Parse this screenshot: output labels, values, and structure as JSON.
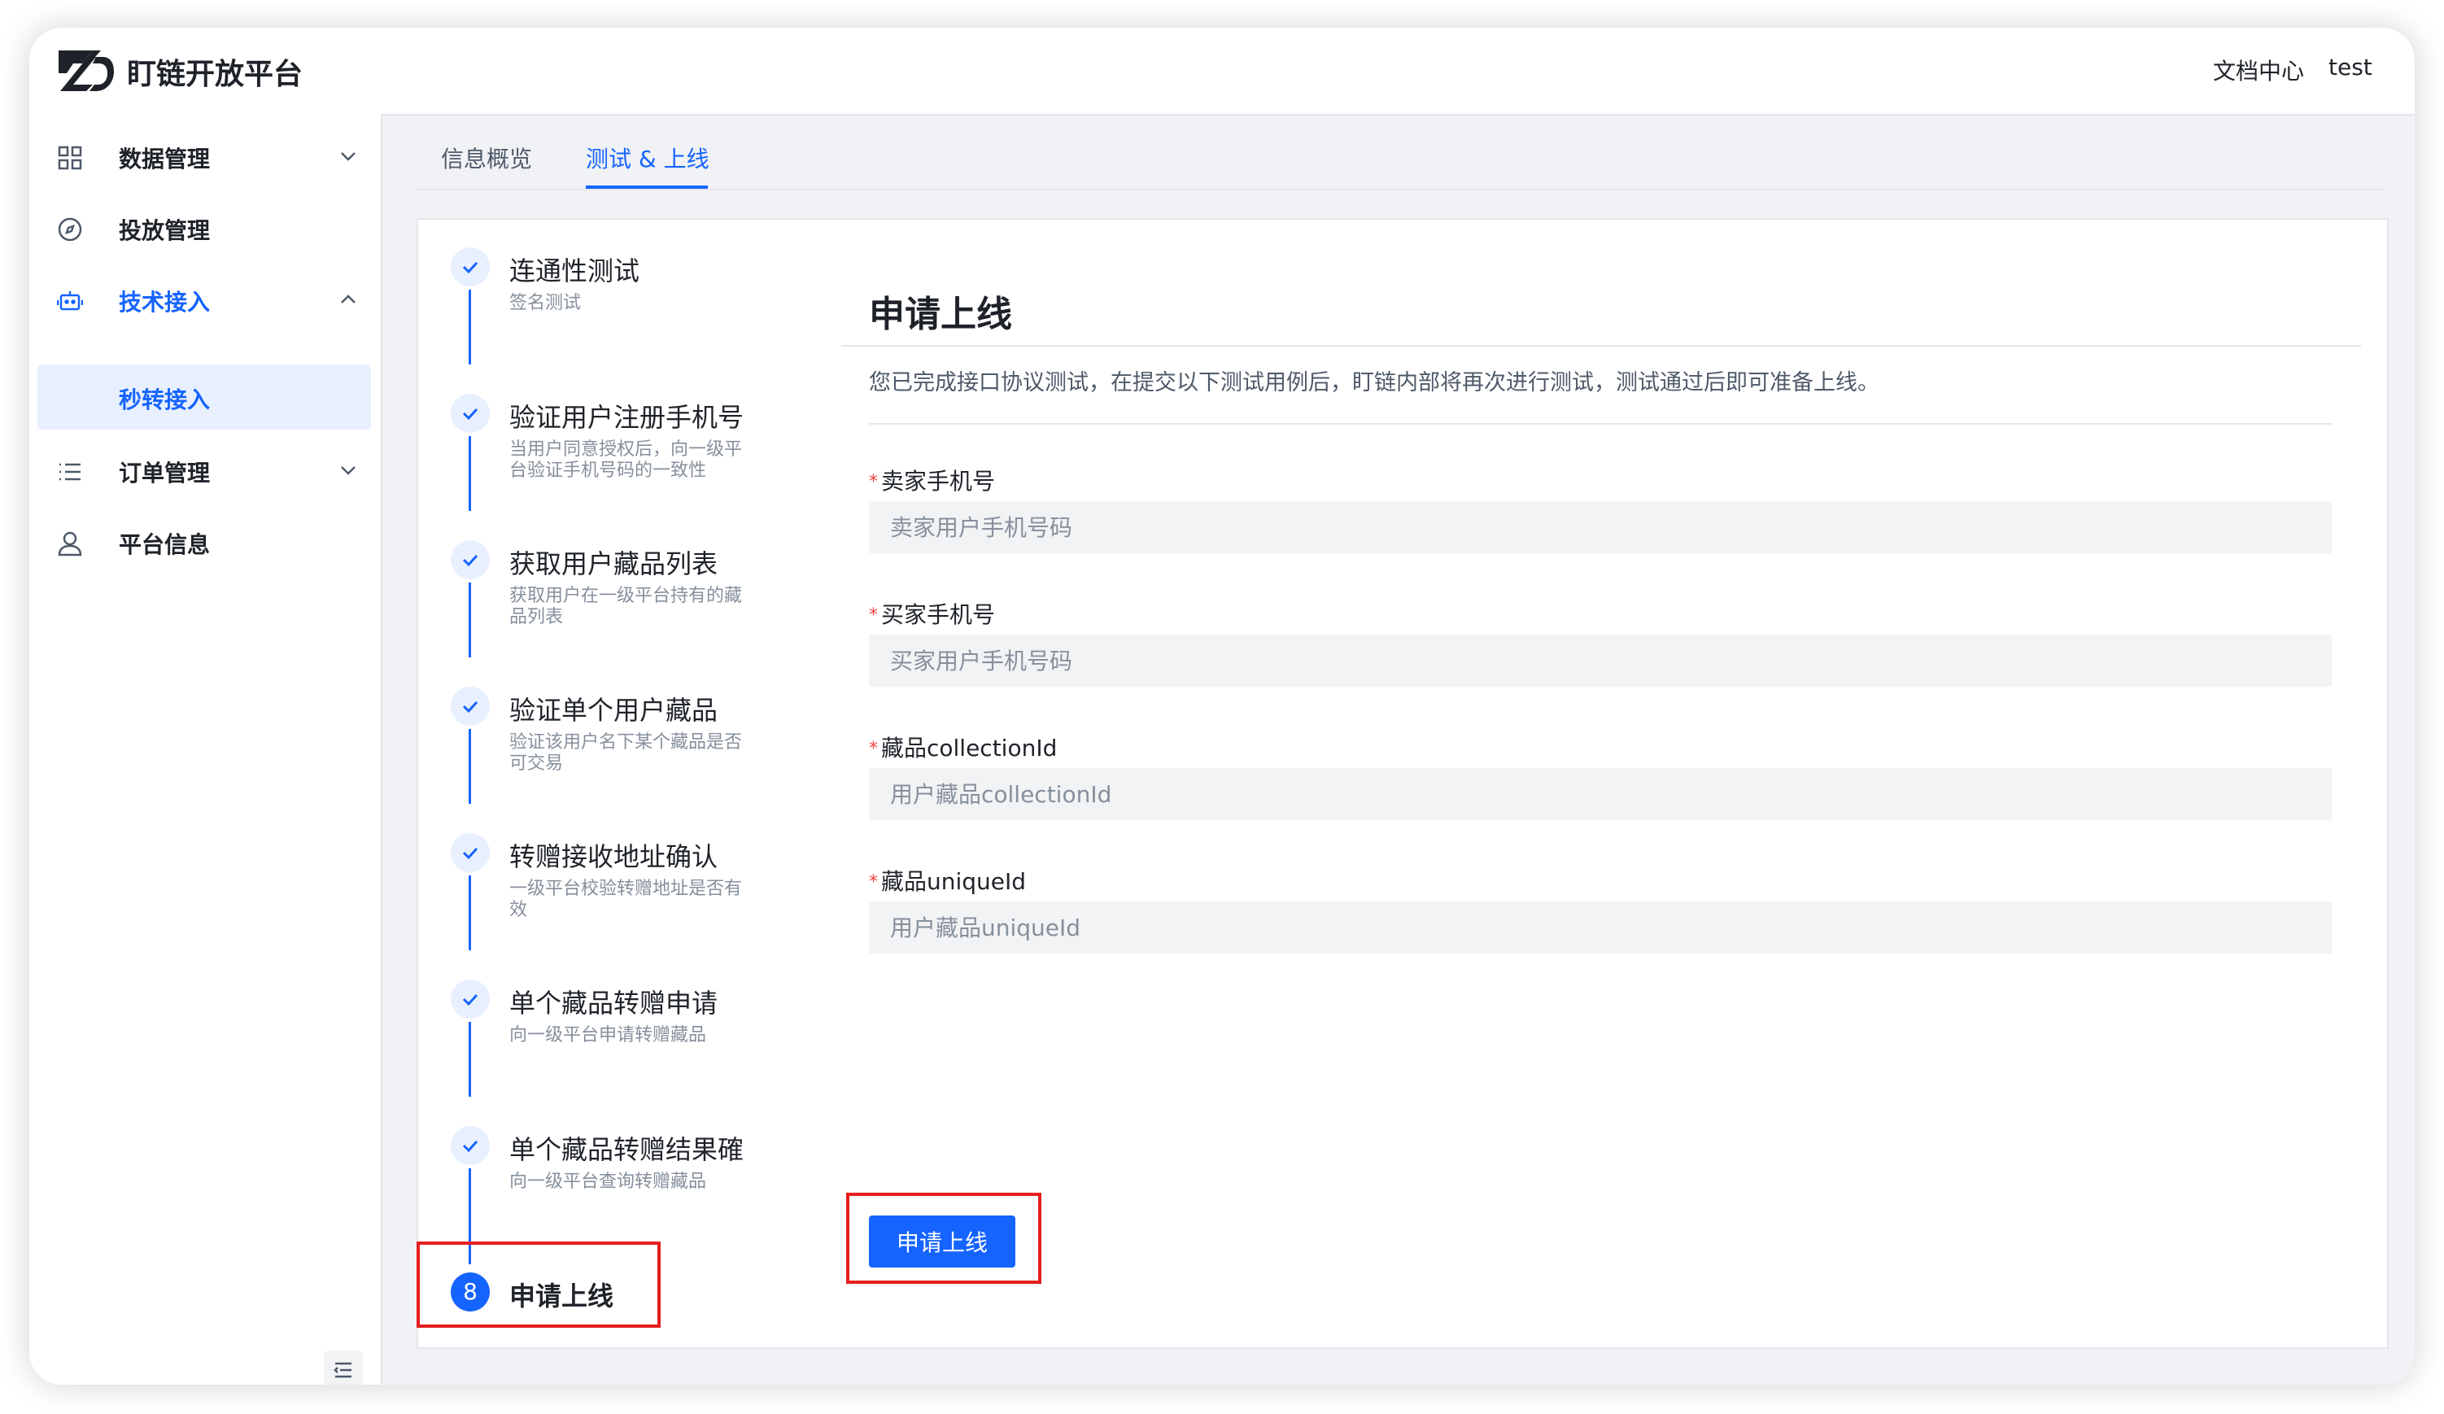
{
  "header": {
    "brand": "盯链开放平台",
    "docs_link": "文档中心",
    "user": "test"
  },
  "sidebar": {
    "items": [
      {
        "label": "数据管理",
        "icon": "grid-icon"
      },
      {
        "label": "投放管理",
        "icon": "compass-icon"
      },
      {
        "label": "技术接入",
        "icon": "robot-icon"
      },
      {
        "label": "秒转接入"
      },
      {
        "label": "订单管理",
        "icon": "list-icon"
      },
      {
        "label": "平台信息",
        "icon": "user-icon"
      }
    ]
  },
  "tabs": [
    {
      "label": "信息概览"
    },
    {
      "label": "测试 & 上线"
    }
  ],
  "steps": [
    {
      "title": "连通性测试",
      "desc": "签名测试"
    },
    {
      "title": "验证用户注册手机号",
      "desc": "当用户同意授权后，向一级平台验证手机号码的一致性"
    },
    {
      "title": "获取用户藏品列表",
      "desc": "获取用户在一级平台持有的藏品列表"
    },
    {
      "title": "验证单个用户藏品",
      "desc": "验证该用户名下某个藏品是否可交易"
    },
    {
      "title": "转赠接收地址确认",
      "desc": "一级平台校验转赠地址是否有效"
    },
    {
      "title": "单个藏品转赠申请",
      "desc": "向一级平台申请转赠藏品"
    },
    {
      "title": "单个藏品转赠结果確",
      "desc": "向一级平台查询转赠藏品"
    },
    {
      "title": "申请上线",
      "number": "8"
    }
  ],
  "panel": {
    "title": "申请上线",
    "description": "您已完成接口协议测试，在提交以下测试用例后，盯链内部将再次进行测试，测试通过后即可准备上线。",
    "fields": [
      {
        "label": "卖家手机号",
        "placeholder": "卖家用户手机号码",
        "value": ""
      },
      {
        "label": "买家手机号",
        "placeholder": "买家用户手机号码",
        "value": ""
      },
      {
        "label": "藏品collectionId",
        "placeholder": "用户藏品collectionId",
        "value": ""
      },
      {
        "label": "藏品uniqueId",
        "placeholder": "用户藏品uniqueId",
        "value": ""
      }
    ],
    "required_mark": "*",
    "submit_label": "申请上线"
  },
  "colors": {
    "accent": "#1664ff",
    "highlight_box": "#e51e1e"
  }
}
